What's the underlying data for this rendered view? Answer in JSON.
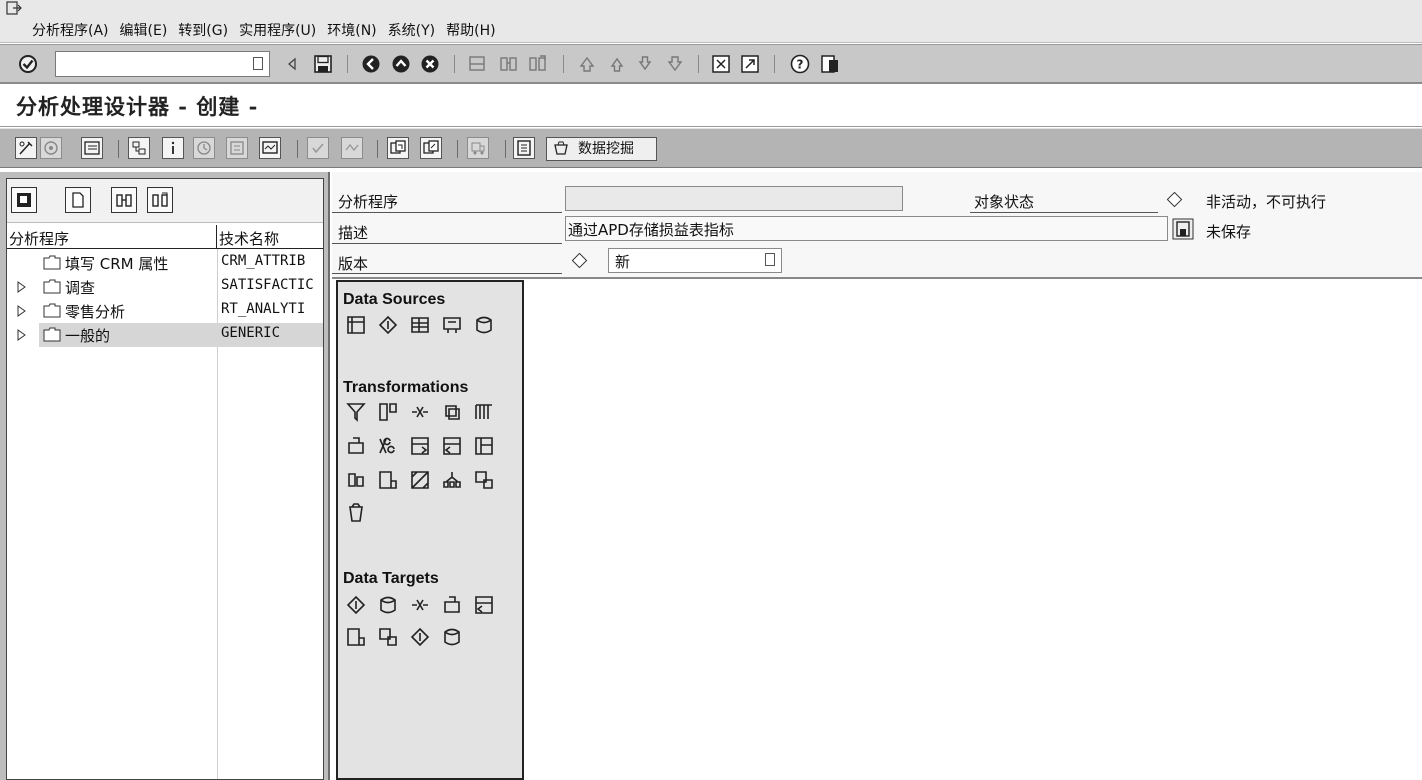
{
  "menu": {
    "items": [
      "分析程序(A)",
      "编辑(E)",
      "转到(G)",
      "实用程序(U)",
      "环境(N)",
      "系统(Y)",
      "帮助(H)"
    ]
  },
  "command_field": {
    "value": ""
  },
  "title": "分析处理设计器 - 创建 -",
  "app_toolbar": {
    "data_mining_label": "数据挖掘"
  },
  "tree": {
    "headers": {
      "name": "分析程序",
      "tech": "技术名称"
    },
    "rows": [
      {
        "label": "填写 CRM 属性",
        "tech": "CRM_ATTRIB",
        "expandable": false,
        "selected": false
      },
      {
        "label": "调查",
        "tech": "SATISFACTIC",
        "expandable": true,
        "selected": false
      },
      {
        "label": "零售分析",
        "tech": "RT_ANALYTI",
        "expandable": true,
        "selected": false
      },
      {
        "label": "一般的",
        "tech": "GENERIC",
        "expandable": true,
        "selected": true
      }
    ]
  },
  "form": {
    "program_label": "分析程序",
    "program_value": "",
    "desc_label": "描述",
    "desc_value": "通过APD存储损益表指标",
    "version_label": "版本",
    "version_value": "新",
    "status_label": "对象状态",
    "status_value": "非活动，不可执行",
    "save_status": "未保存"
  },
  "palette": {
    "sources_title": "Data Sources",
    "transformations_title": "Transformations",
    "targets_title": "Data Targets",
    "source_icons": [
      "infoprovider-icon",
      "query-icon",
      "table-icon",
      "flatfile-icon",
      "database-icon"
    ],
    "transformation_icons": [
      "filter-icon",
      "projection-icon",
      "join-icon",
      "union-icon",
      "aggregation-icon",
      "sort-icon",
      "percent-icon",
      "routine-icon",
      "list-to-table-icon",
      "table-to-list-icon",
      "hierarchy-join-icon",
      "data-transformation-icon",
      "abc-classification-icon",
      "decision-tree-icon",
      "cluster-icon",
      "data-mining-model-icon"
    ],
    "target_icons": [
      "ods-object-icon",
      "database-table-icon",
      "crm-attribute-icon",
      "crm-model-icon",
      "decision-tree-target-icon",
      "cluster-target-icon",
      "association-icon",
      "scoring-icon",
      "mining-target-icon"
    ]
  }
}
